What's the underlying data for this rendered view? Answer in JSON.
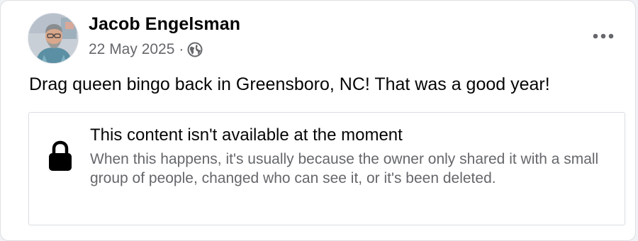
{
  "post": {
    "author_name": "Jacob Engelsman",
    "date": "22 May 2025",
    "separator": "·",
    "audience_icon": "globe-icon",
    "more_icon": "more-options-icon",
    "text": "Drag queen bingo back in Greensboro, NC! That was a good year!"
  },
  "unavailable": {
    "icon": "lock-icon",
    "title": "This content isn't available at the moment",
    "body": "When this happens, it's usually because the owner only shared it with a small group of people, changed who can see it, or it's been deleted."
  },
  "colors": {
    "primary_text": "#050505",
    "secondary_text": "#65676b",
    "card_background": "#ffffff",
    "border": "#dadde1"
  }
}
